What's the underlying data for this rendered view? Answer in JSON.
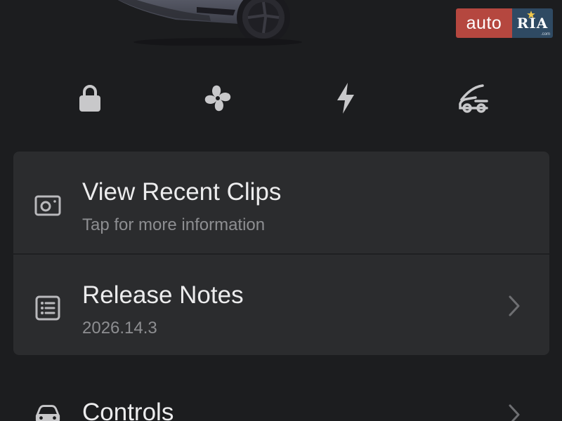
{
  "watermark": {
    "left_text": "auto",
    "right_text": "RIA",
    "domain_text": ".com"
  },
  "quick_actions": [
    {
      "icon": "lock-icon"
    },
    {
      "icon": "fan-icon"
    },
    {
      "icon": "bolt-icon"
    },
    {
      "icon": "frunk-icon"
    }
  ],
  "menu": {
    "recent_clips": {
      "title": "View Recent Clips",
      "subtitle": "Tap for more information",
      "icon": "camera-icon"
    },
    "release_notes": {
      "title": "Release Notes",
      "subtitle": "2026.14.3",
      "icon": "list-icon"
    },
    "controls": {
      "title": "Controls",
      "icon": "car-icon"
    }
  },
  "colors": {
    "background": "#1c1d1f",
    "card": "#2b2c2e",
    "icon": "#c8c8ca",
    "subtitle": "#8d8e91",
    "watermark_red": "#b5473f",
    "watermark_blue": "#2f4a63"
  }
}
